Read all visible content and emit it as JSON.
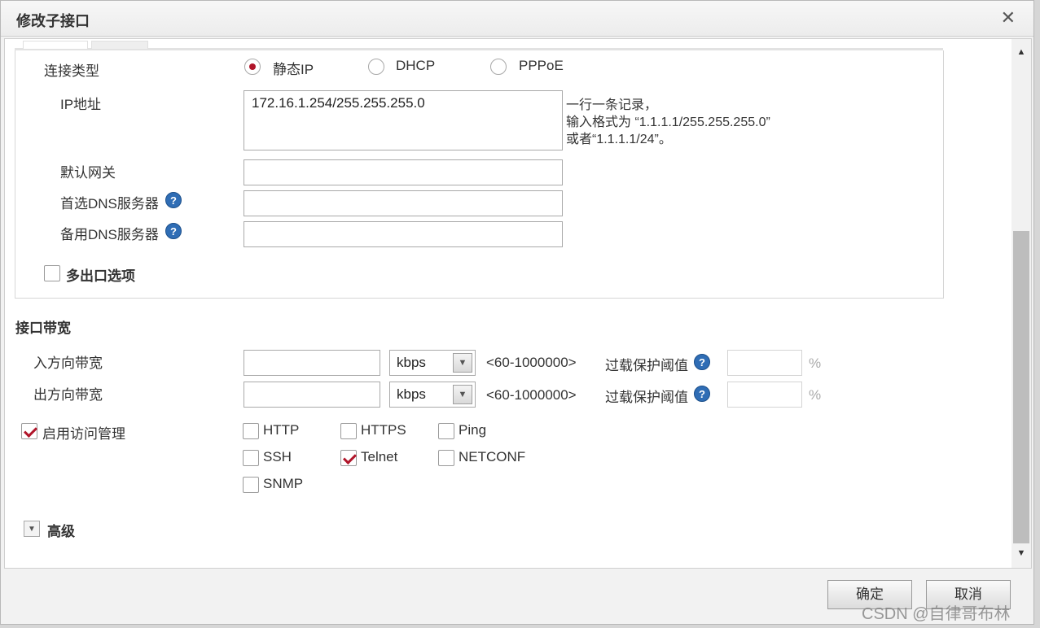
{
  "dialog": {
    "title": "修改子接口",
    "close": "✕"
  },
  "conn": {
    "label": "连接类型",
    "options": [
      "静态IP",
      "DHCP",
      "PPPoE"
    ],
    "selected": "静态IP"
  },
  "ip": {
    "label": "IP地址",
    "value": "172.16.1.254/255.255.255.0",
    "hint": "一行一条记录，\n输入格式为 “1.1.1.1/255.255.255.0”\n或者“1.1.1.1/24”。"
  },
  "gateway": {
    "label": "默认网关",
    "value": ""
  },
  "dns1": {
    "label": "首选DNS服务器",
    "value": ""
  },
  "dns2": {
    "label": "备用DNS服务器",
    "value": ""
  },
  "multi_exit": {
    "label": "多出口选项",
    "checked": false
  },
  "bandwidth": {
    "title": "接口带宽",
    "rows": [
      {
        "label": "入方向带宽",
        "value": "",
        "unit": "kbps",
        "range": "<60-1000000>",
        "overload_label": "过载保护阈值",
        "overload_value": "",
        "pct": "%"
      },
      {
        "label": "出方向带宽",
        "value": "",
        "unit": "kbps",
        "range": "<60-1000000>",
        "overload_label": "过载保护阈值",
        "overload_value": "",
        "pct": "%"
      }
    ]
  },
  "access": {
    "label": "启用访问管理",
    "enabled": true,
    "protocols": [
      {
        "name": "HTTP",
        "checked": false
      },
      {
        "name": "HTTPS",
        "checked": false
      },
      {
        "name": "Ping",
        "checked": false
      },
      {
        "name": "SSH",
        "checked": false
      },
      {
        "name": "Telnet",
        "checked": true
      },
      {
        "name": "NETCONF",
        "checked": false
      },
      {
        "name": "SNMP",
        "checked": false
      }
    ]
  },
  "advanced": {
    "label": "高级"
  },
  "help_glyph": "?",
  "footer": {
    "ok": "确定",
    "cancel": "取消"
  },
  "watermark": "CSDN @自律哥布林",
  "colors": {
    "accent": "#b0152a",
    "help": "#2f6db5"
  }
}
